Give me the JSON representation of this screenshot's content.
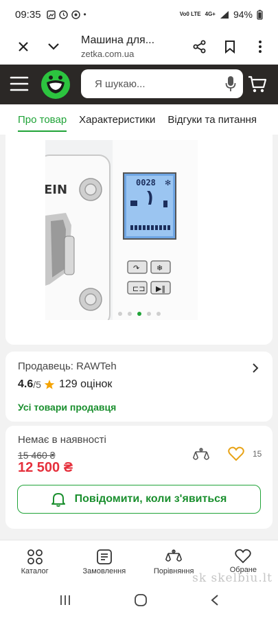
{
  "status": {
    "time": "09:35",
    "battery": "94%",
    "net_top": "Vo0 LTE",
    "net_sig": "4G+"
  },
  "browser": {
    "title": "Машина для...",
    "url": "zetka.com.ua"
  },
  "search": {
    "placeholder": "Я шукаю..."
  },
  "tabs": [
    {
      "label": "Про товар",
      "active": true
    },
    {
      "label": "Характеристики"
    },
    {
      "label": "Відгуки та питання"
    }
  ],
  "product_image": {
    "display_time": "0028",
    "brand_fragment": "EIN",
    "carousel": {
      "count": 6,
      "active_index": 3
    }
  },
  "seller": {
    "label": "Продавець: RAWTeh",
    "rating": "4.6",
    "rating_max": "/5",
    "reviews": "129 оцінок",
    "all_products_link": "Усі товари продавця"
  },
  "offer": {
    "availability": "Немає в наявності",
    "old_price": "15 460 ₴",
    "price": "12 500 ₴",
    "favorites_count": "15",
    "notify_button": "Повідомити, коли з'явиться"
  },
  "bottom_nav": [
    {
      "label": "Каталог",
      "icon": "catalog-icon"
    },
    {
      "label": "Замовлення",
      "icon": "orders-icon"
    },
    {
      "label": "Порівняння",
      "icon": "compare-icon"
    },
    {
      "label": "Обране",
      "icon": "heart-icon"
    }
  ],
  "watermark": "sk skelbiu.lt",
  "colors": {
    "accent": "#1fa337",
    "price": "#e5303c",
    "header": "#2b2826"
  }
}
